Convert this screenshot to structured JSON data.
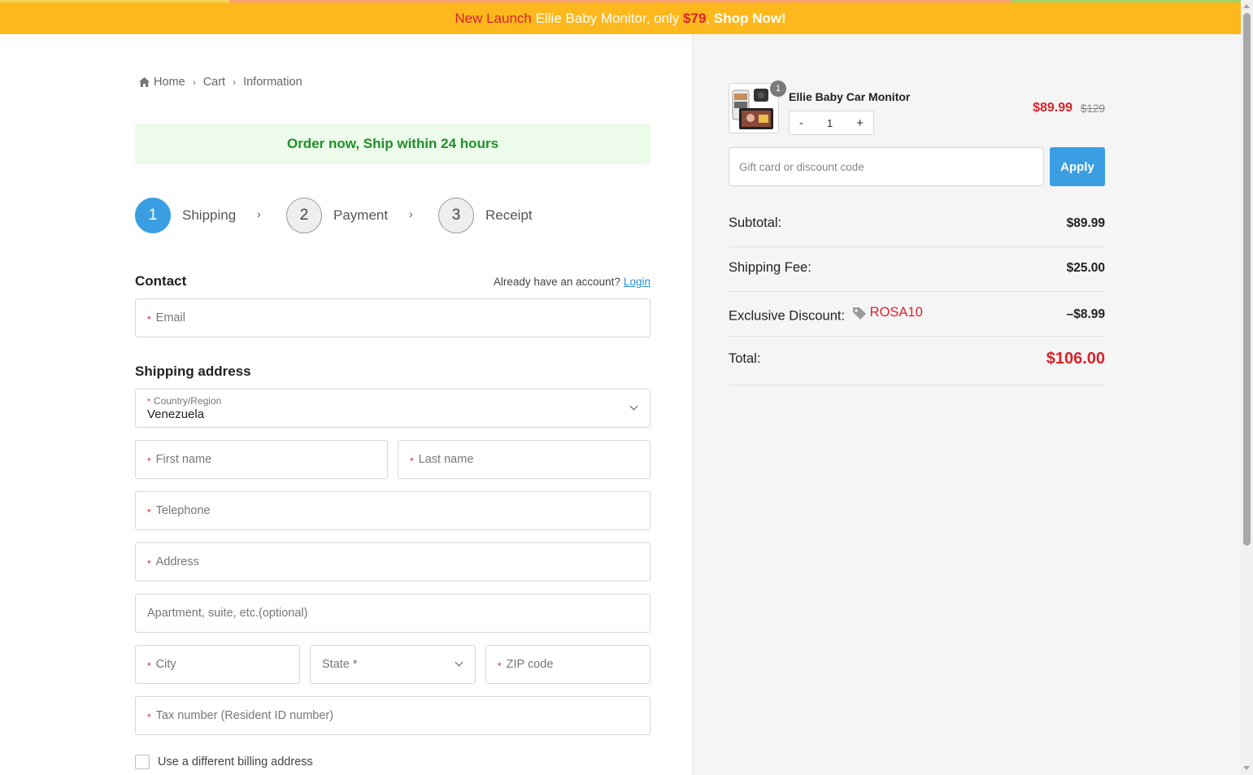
{
  "announcement": {
    "prefix": "New Launch",
    "middle": "Ellie Baby Monitor, only",
    "price": "$79",
    "comma": ",",
    "cta": "Shop Now!"
  },
  "breadcrumb": {
    "home": "Home",
    "cart": "Cart",
    "information": "Information"
  },
  "promo_text": "Order now, Ship within 24 hours",
  "steps": [
    {
      "number": "1",
      "label": "Shipping"
    },
    {
      "number": "2",
      "label": "Payment"
    },
    {
      "number": "3",
      "label": "Receipt"
    }
  ],
  "contact": {
    "title": "Contact",
    "account_prompt": "Already have an account?",
    "login": "Login",
    "email_placeholder": "Email"
  },
  "shipping": {
    "title": "Shipping address",
    "country_label": "Country/Region",
    "country_value": "Venezuela",
    "first_name": "First name",
    "last_name": "Last name",
    "telephone": "Telephone",
    "address": "Address",
    "apartment": "Apartment, suite, etc.(optional)",
    "city": "City",
    "state": "State *",
    "zip": "ZIP code",
    "tax": "Tax number (Resident ID number)",
    "billing_checkbox": "Use a different billing address"
  },
  "summary": {
    "product_name": "Ellie Baby Car Monitor",
    "badge_count": "1",
    "qty_minus": "-",
    "qty_value": "1",
    "qty_plus": "+",
    "price_now": "$89.99",
    "price_old": "$129",
    "coupon_placeholder": "Gift card or discount code",
    "apply": "Apply",
    "subtotal_label": "Subtotal:",
    "subtotal_value": "$89.99",
    "shipping_label": "Shipping Fee:",
    "shipping_value": "$25.00",
    "discount_label": "Exclusive Discount:",
    "discount_code": "ROSA10",
    "discount_value": "–$8.99",
    "total_label": "Total:",
    "total_value": "$106.00"
  },
  "colors": {
    "announce_bg": "#fdb81e",
    "accent_blue": "#3a9ee3",
    "price_red": "#d9232b",
    "promo_green": "#1f8f2a"
  }
}
